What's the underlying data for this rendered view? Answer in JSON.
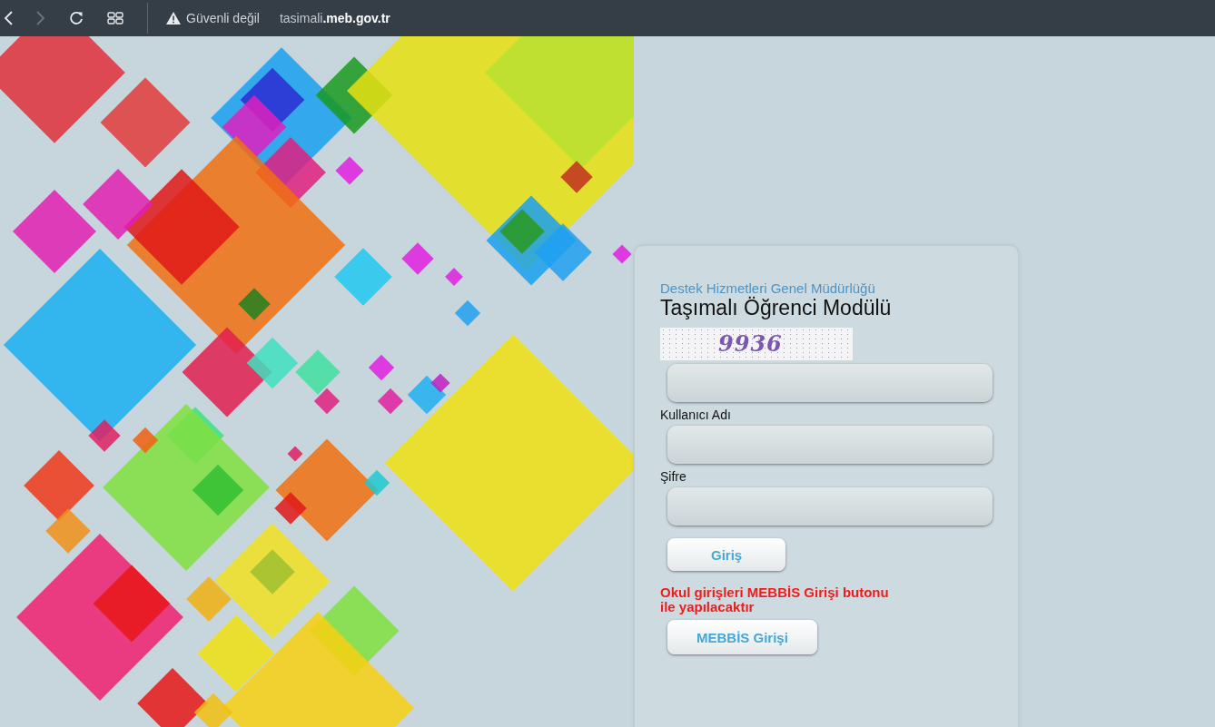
{
  "browser": {
    "security_label": "Güvenli değil",
    "url": "tasimali**.meb.gov.tr**"
  },
  "login": {
    "subtitle": "Destek Hizmetleri Genel Müdürlüğü",
    "title": "Taşımalı Öğrenci Modülü",
    "items": [
      {
        "kind": "captcha",
        "text": "9936"
      },
      {
        "kind": "field"
      },
      {
        "kind": "label",
        "text": "Kullanıcı Adı"
      },
      {
        "kind": "field"
      },
      {
        "kind": "label",
        "text": "Şifre"
      },
      {
        "kind": "field"
      },
      {
        "kind": "button",
        "text": "Giriş"
      },
      {
        "kind": "note",
        "text": "Okul girişleri MEBBİS Girişi butonu ile yapılacaktır"
      },
      {
        "kind": "button",
        "text": "MEBBİS Girişi"
      }
    ]
  }
}
